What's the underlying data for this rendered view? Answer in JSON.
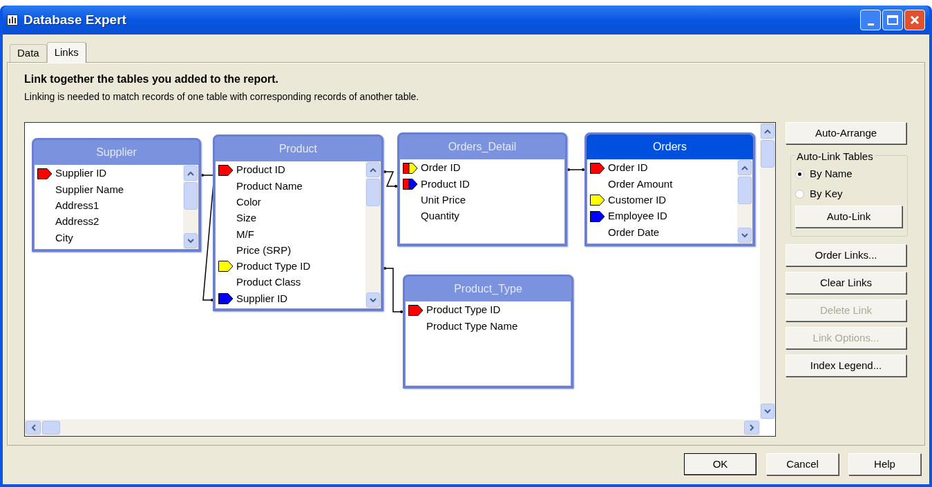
{
  "window": {
    "title": "Database Expert"
  },
  "tabs": [
    {
      "label": "Data",
      "selected": false
    },
    {
      "label": "Links",
      "selected": true
    }
  ],
  "heading": "Link together the tables you added to the report.",
  "description": "Linking is needed to match records of one table with corresponding records of another table.",
  "tables": [
    {
      "name": "Supplier",
      "selected": false,
      "scrollbar": true,
      "fields": [
        {
          "name": "Supplier ID",
          "keys": [
            {
              "color": "#ff0000"
            }
          ]
        },
        {
          "name": "Supplier Name"
        },
        {
          "name": "Address1"
        },
        {
          "name": "Address2"
        },
        {
          "name": "City"
        }
      ]
    },
    {
      "name": "Product",
      "selected": false,
      "scrollbar": true,
      "fields": [
        {
          "name": "Product ID",
          "keys": [
            {
              "color": "#ff0000"
            }
          ]
        },
        {
          "name": "Product Name"
        },
        {
          "name": "Color"
        },
        {
          "name": "Size"
        },
        {
          "name": "M/F"
        },
        {
          "name": "Price (SRP)"
        },
        {
          "name": "Product Type ID",
          "keys": [
            {
              "color": "#ffff00"
            }
          ]
        },
        {
          "name": "Product Class"
        },
        {
          "name": "Supplier ID",
          "keys": [
            {
              "color": "#0000ff"
            }
          ]
        }
      ]
    },
    {
      "name": "Orders_Detail",
      "selected": false,
      "scrollbar": false,
      "fields": [
        {
          "name": "Order ID",
          "keys": [
            {
              "color": "#ff0000"
            },
            {
              "color": "#ffff00"
            }
          ]
        },
        {
          "name": "Product ID",
          "keys": [
            {
              "color": "#ff0000"
            },
            {
              "color": "#0000ff"
            }
          ]
        },
        {
          "name": "Unit Price"
        },
        {
          "name": "Quantity"
        }
      ]
    },
    {
      "name": "Orders",
      "selected": true,
      "scrollbar": true,
      "fields": [
        {
          "name": "Order ID",
          "keys": [
            {
              "color": "#ff0000"
            }
          ]
        },
        {
          "name": "Order Amount"
        },
        {
          "name": "Customer ID",
          "keys": [
            {
              "color": "#ffff00"
            }
          ]
        },
        {
          "name": "Employee ID",
          "keys": [
            {
              "color": "#0000ff"
            }
          ]
        },
        {
          "name": "Order Date"
        }
      ]
    },
    {
      "name": "Product_Type",
      "selected": false,
      "scrollbar": false,
      "fields": [
        {
          "name": "Product Type ID",
          "keys": [
            {
              "color": "#ff0000"
            }
          ]
        },
        {
          "name": "Product Type Name"
        }
      ]
    }
  ],
  "top_button": {
    "label": "Auto-Arrange",
    "disabled": false
  },
  "auto_link": {
    "title": "Auto-Link Tables",
    "options": [
      {
        "label": "By Name",
        "selected": true
      },
      {
        "label": "By Key",
        "selected": false
      }
    ],
    "button": {
      "label": "Auto-Link",
      "disabled": false
    }
  },
  "link_buttons": [
    {
      "label": "Order Links...",
      "disabled": false
    },
    {
      "label": "Clear Links",
      "disabled": false
    },
    {
      "label": "Delete Link",
      "disabled": true
    },
    {
      "label": "Link Options...",
      "disabled": true
    },
    {
      "label": "Index Legend...",
      "disabled": false
    }
  ],
  "footer_buttons": [
    {
      "label": "OK",
      "default": true
    },
    {
      "label": "Cancel",
      "default": false
    },
    {
      "label": "Help",
      "default": false
    }
  ]
}
